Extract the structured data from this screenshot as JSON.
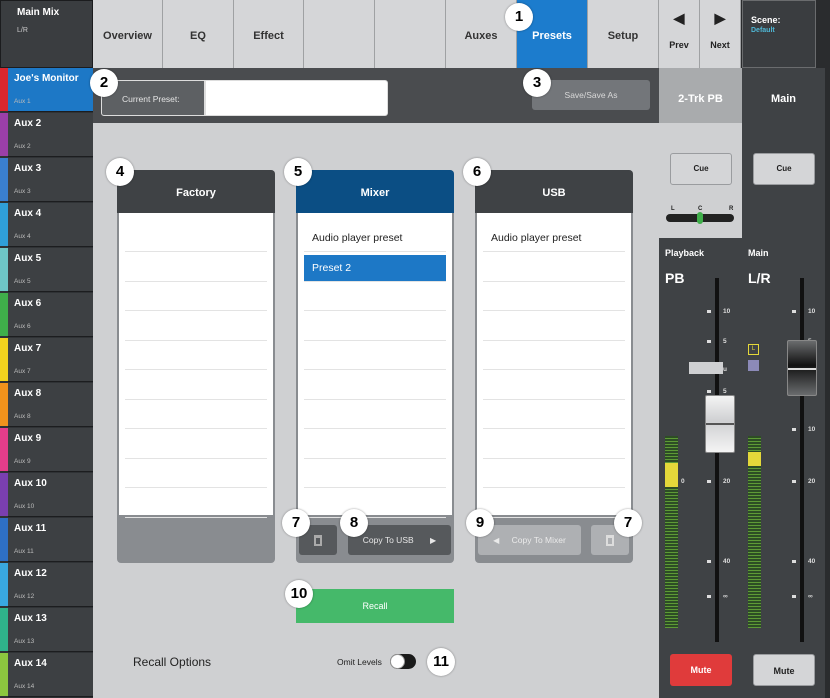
{
  "main_mix": {
    "title": "Main Mix",
    "subtitle": "L/R"
  },
  "aux_list": [
    {
      "name": "Joe's Monitor",
      "sub": "Aux 1",
      "color": "#d9282f"
    },
    {
      "name": "Aux 2",
      "sub": "Aux 2",
      "color": "#9b3fa8"
    },
    {
      "name": "Aux 3",
      "sub": "Aux 3",
      "color": "#3a7fcf"
    },
    {
      "name": "Aux 4",
      "sub": "Aux 4",
      "color": "#2f9fd8"
    },
    {
      "name": "Aux 5",
      "sub": "Aux 5",
      "color": "#6ec6c6"
    },
    {
      "name": "Aux 6",
      "sub": "Aux 6",
      "color": "#3fae4a"
    },
    {
      "name": "Aux 7",
      "sub": "Aux 7",
      "color": "#f2d21e"
    },
    {
      "name": "Aux 8",
      "sub": "Aux 8",
      "color": "#f0921c"
    },
    {
      "name": "Aux 9",
      "sub": "Aux 9",
      "color": "#e43d8a"
    },
    {
      "name": "Aux 10",
      "sub": "Aux 10",
      "color": "#7a3fb0"
    },
    {
      "name": "Aux 11",
      "sub": "Aux 11",
      "color": "#2e6fc4"
    },
    {
      "name": "Aux 12",
      "sub": "Aux 12",
      "color": "#39a8e0"
    },
    {
      "name": "Aux 13",
      "sub": "Aux 13",
      "color": "#2fb38a"
    },
    {
      "name": "Aux 14",
      "sub": "Aux 14",
      "color": "#8cc63f"
    }
  ],
  "tabs": [
    "Overview",
    "EQ",
    "Effect",
    "",
    "",
    "Auxes",
    "Presets",
    "Setup"
  ],
  "nav": {
    "prev": "Prev",
    "next": "Next"
  },
  "scene": {
    "label": "Scene:",
    "value": "Default"
  },
  "preset_bar": {
    "current_label": "Current Preset:",
    "current_value": "",
    "save_label": "Save/Save As"
  },
  "columns": {
    "factory": {
      "title": "Factory",
      "items": []
    },
    "mixer": {
      "title": "Mixer",
      "items": [
        "Audio player preset",
        "Preset 2"
      ],
      "selected": "Preset 2",
      "copy_label": "Copy To USB"
    },
    "usb": {
      "title": "USB",
      "items": [
        "Audio player preset"
      ],
      "copy_label": "Copy To Mixer"
    }
  },
  "recall_label": "Recall",
  "recall_options_label": "Recall Options",
  "omit_levels_label": "Omit Levels",
  "callouts": [
    "1",
    "2",
    "3",
    "4",
    "5",
    "6",
    "7",
    "8",
    "9",
    "10",
    "7",
    "11"
  ],
  "strips": {
    "pb": {
      "header": "2-Trk PB",
      "cue": "Cue",
      "pan_l": "L",
      "pan_c": "C",
      "pan_r": "R",
      "label": "Playback",
      "name": "PB",
      "mute": "Mute",
      "scale": [
        "10",
        "5",
        "u",
        "5",
        "10",
        "20",
        "40",
        "∞"
      ],
      "meter_zero": "0"
    },
    "main": {
      "header": "Main",
      "cue": "Cue",
      "label": "Main",
      "name": "L/R",
      "mute": "Mute",
      "scale": [
        "10",
        "5",
        "u",
        "5",
        "10",
        "20",
        "40",
        "∞"
      ],
      "lr_box": "L"
    }
  },
  "colors": {
    "accent": "#1c7ccd",
    "recall": "#45b96a",
    "mute_active": "#e03b3b"
  }
}
